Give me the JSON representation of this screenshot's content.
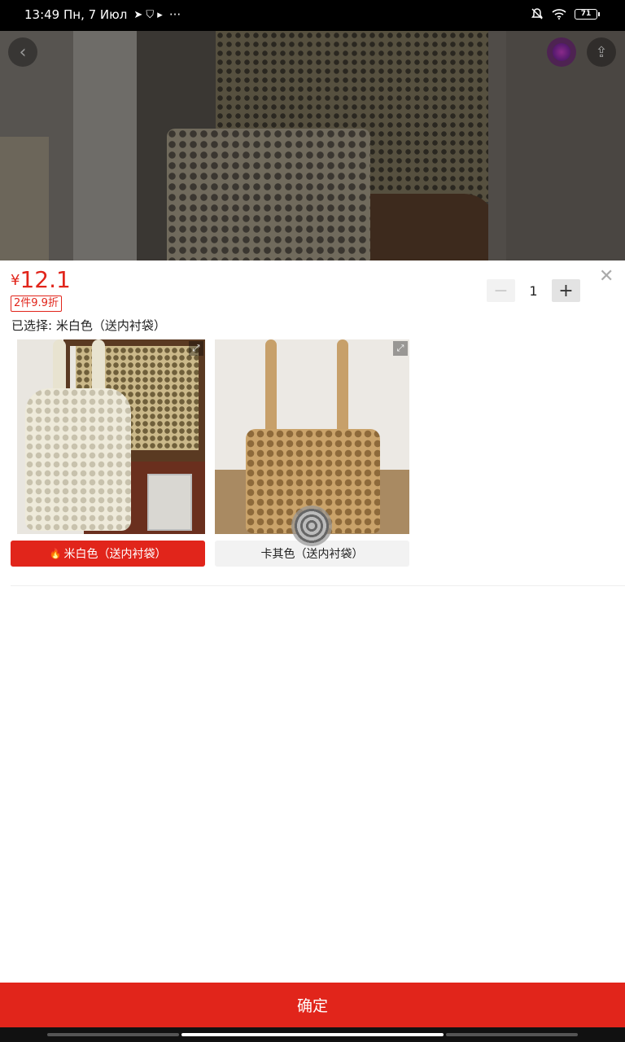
{
  "status_bar": {
    "time_date": "13:49 Пн, 7 Июл",
    "notif_symbols": "➤ ⛉ ▸",
    "more": "···",
    "battery": "71"
  },
  "hero": {
    "back_icon": "‹",
    "share_icon": "⇪"
  },
  "product": {
    "currency": "¥",
    "price": "12.1",
    "promo": "2件9.9折",
    "selected_prefix": "已选择:",
    "selected_value": "米白色（送内衬袋）",
    "close_icon": "✕"
  },
  "quantity": {
    "minus": "−",
    "value": "1",
    "plus": "+"
  },
  "variants": [
    {
      "label": "米白色（送内衬袋）",
      "selected": true
    },
    {
      "label": "卡其色（送内衬袋）",
      "selected": false
    }
  ],
  "expand_glyph": "⤢",
  "fire_glyph": "🔥",
  "confirm_label": "确定",
  "colors": {
    "accent": "#e1251b"
  }
}
